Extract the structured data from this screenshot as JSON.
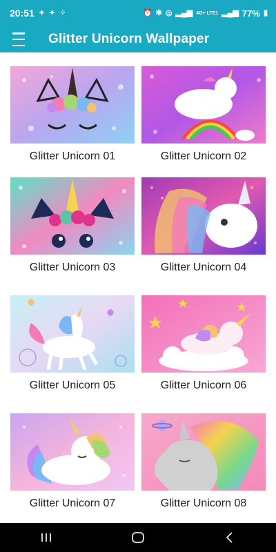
{
  "status_bar": {
    "time": "20:51",
    "battery": "77%",
    "network": "4G+ LTE1"
  },
  "app_bar": {
    "title": "Glitter Unicorn Wallpaper",
    "menu_icon": "hamburger-menu-icon",
    "background_color": "#1aa9c2"
  },
  "wallpapers": [
    {
      "label": "Glitter Unicorn 01"
    },
    {
      "label": "Glitter Unicorn 02"
    },
    {
      "label": "Glitter Unicorn 03"
    },
    {
      "label": "Glitter Unicorn 04"
    },
    {
      "label": "Glitter Unicorn 05"
    },
    {
      "label": "Glitter Unicorn 06"
    },
    {
      "label": "Glitter Unicorn 07"
    },
    {
      "label": "Glitter Unicorn 08"
    }
  ],
  "nav_bar": {
    "recents_icon": "recents-icon",
    "home_icon": "home-icon",
    "back_icon": "back-icon"
  }
}
